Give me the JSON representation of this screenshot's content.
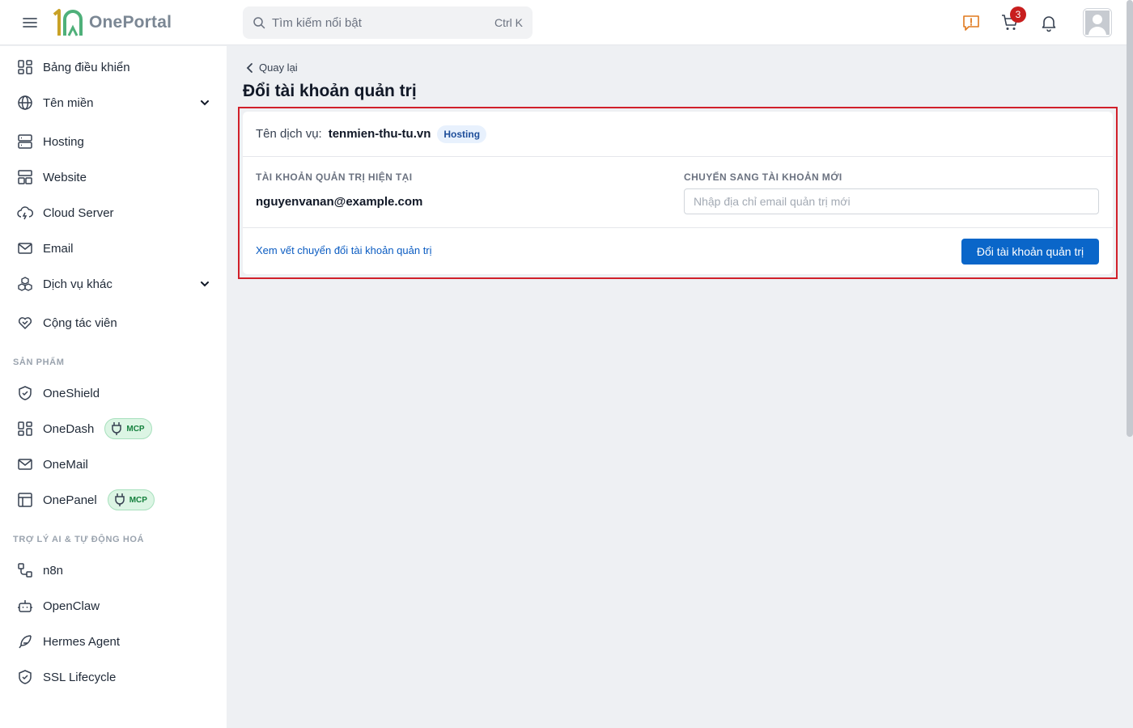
{
  "app": {
    "name": "OnePortal"
  },
  "search": {
    "placeholder": "Tìm kiếm nổi bật",
    "shortcut": "Ctrl K"
  },
  "header": {
    "cart_count": "3"
  },
  "sidebar": {
    "items": [
      {
        "label": "Bảng điều khiển",
        "icon": "dashboard-icon"
      },
      {
        "label": "Tên miền",
        "icon": "globe-icon",
        "expandable": true
      },
      {
        "label": "Hosting",
        "icon": "server-icon"
      },
      {
        "label": "Website",
        "icon": "layout-icon"
      },
      {
        "label": "Cloud Server",
        "icon": "cloud-icon"
      },
      {
        "label": "Email",
        "icon": "mail-icon"
      },
      {
        "label": "Dịch vụ khác",
        "icon": "boxes-icon",
        "expandable": true
      },
      {
        "label": "Cộng tác viên",
        "icon": "handshake-icon"
      }
    ],
    "products_title": "SẢN PHẨM",
    "products": [
      {
        "label": "OneShield",
        "icon": "shield-icon"
      },
      {
        "label": "OneDash",
        "icon": "dashboard-icon",
        "badge": "MCP"
      },
      {
        "label": "OneMail",
        "icon": "mail-icon"
      },
      {
        "label": "OnePanel",
        "icon": "panel-icon",
        "badge": "MCP"
      }
    ],
    "ai_title": "TRỢ LÝ AI & TỰ ĐỘNG HOÁ",
    "ai": [
      {
        "label": "n8n",
        "icon": "workflow-icon"
      },
      {
        "label": "OpenClaw",
        "icon": "bot-icon"
      },
      {
        "label": "Hermes Agent",
        "icon": "feather-icon"
      },
      {
        "label": "SSL Lifecycle",
        "icon": "shield-check-icon"
      }
    ]
  },
  "main": {
    "back_label": "Quay lại",
    "title": "Đổi tài khoản quản trị",
    "service_label": "Tên dịch vụ:",
    "service_name": "tenmien-thu-tu.vn",
    "service_type": "Hosting",
    "current_title": "TÀI KHOẢN QUẢN TRỊ HIỆN TẠI",
    "current_email": "nguyenvanan@example.com",
    "new_title": "CHUYỂN SANG TÀI KHOẢN MỚI",
    "new_placeholder": "Nhập địa chỉ email quản trị mới",
    "new_value": "",
    "history_link": "Xem vết chuyển đổi tài khoản quản trị",
    "submit_label": "Đổi tài khoản quản trị"
  },
  "colors": {
    "primary": "#0a66c9",
    "highlight": "#d1202a",
    "badge_red": "#c81e1e",
    "mcp_green": "#15803d"
  }
}
